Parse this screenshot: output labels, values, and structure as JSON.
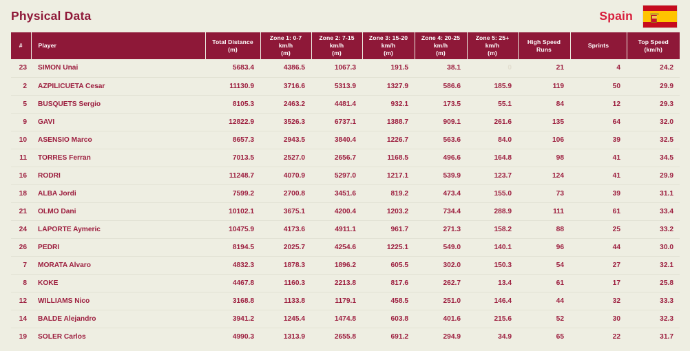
{
  "header": {
    "title": "Physical Data",
    "team": "Spain",
    "flag_icon": "spain-flag-icon",
    "title_color": "#8e1838",
    "team_color": "#d81e3c",
    "header_band_color": "#8e1838",
    "background_color": "#eeeee2",
    "value_color": "#9c1d3e"
  },
  "table": {
    "columns": [
      {
        "key": "num",
        "label": "#"
      },
      {
        "key": "name",
        "label": "Player"
      },
      {
        "key": "total",
        "label": "Total Distance\n(m)",
        "line1": "Total Distance",
        "line2": "(m)"
      },
      {
        "key": "z1",
        "label": "Zone 1: 0-7 km/h\n(m)",
        "line1": "Zone 1: 0-7 km/h",
        "line2": "(m)"
      },
      {
        "key": "z2",
        "label": "Zone 2: 7-15 km/h\n(m)",
        "line1": "Zone 2: 7-15 km/h",
        "line2": "(m)"
      },
      {
        "key": "z3",
        "label": "Zone 3: 15-20 km/h\n(m)",
        "line1": "Zone 3: 15-20 km/h",
        "line2": "(m)"
      },
      {
        "key": "z4",
        "label": "Zone 4: 20-25 km/h\n(m)",
        "line1": "Zone 4: 20-25 km/h",
        "line2": "(m)"
      },
      {
        "key": "z5",
        "label": "Zone 5: 25+ km/h\n(m)",
        "line1": "Zone 5: 25+ km/h",
        "line2": "(m)"
      },
      {
        "key": "hsr",
        "label": "High Speed Runs",
        "line1": "High Speed Runs",
        "line2": ""
      },
      {
        "key": "spr",
        "label": "Sprints",
        "line1": "Sprints",
        "line2": ""
      },
      {
        "key": "ts",
        "label": "Top Speed\n(km/h)",
        "line1": "Top Speed",
        "line2": "(km/h)"
      }
    ],
    "rows": [
      {
        "num": "23",
        "name": "SIMON Unai",
        "total": "5683.4",
        "z1": "4386.5",
        "z2": "1067.3",
        "z3": "191.5",
        "z4": "38.1",
        "z5": "0",
        "z5_faint": true,
        "hsr": "21",
        "spr": "4",
        "ts": "24.2"
      },
      {
        "num": "2",
        "name": "AZPILICUETA Cesar",
        "total": "11130.9",
        "z1": "3716.6",
        "z2": "5313.9",
        "z3": "1327.9",
        "z4": "586.6",
        "z5": "185.9",
        "z5_faint": false,
        "hsr": "119",
        "spr": "50",
        "ts": "29.9"
      },
      {
        "num": "5",
        "name": "BUSQUETS Sergio",
        "total": "8105.3",
        "z1": "2463.2",
        "z2": "4481.4",
        "z3": "932.1",
        "z4": "173.5",
        "z5": "55.1",
        "z5_faint": false,
        "hsr": "84",
        "spr": "12",
        "ts": "29.3"
      },
      {
        "num": "9",
        "name": "GAVI",
        "total": "12822.9",
        "z1": "3526.3",
        "z2": "6737.1",
        "z3": "1388.7",
        "z4": "909.1",
        "z5": "261.6",
        "z5_faint": false,
        "hsr": "135",
        "spr": "64",
        "ts": "32.0"
      },
      {
        "num": "10",
        "name": "ASENSIO Marco",
        "total": "8657.3",
        "z1": "2943.5",
        "z2": "3840.4",
        "z3": "1226.7",
        "z4": "563.6",
        "z5": "84.0",
        "z5_faint": false,
        "hsr": "106",
        "spr": "39",
        "ts": "32.5"
      },
      {
        "num": "11",
        "name": "TORRES Ferran",
        "total": "7013.5",
        "z1": "2527.0",
        "z2": "2656.7",
        "z3": "1168.5",
        "z4": "496.6",
        "z5": "164.8",
        "z5_faint": false,
        "hsr": "98",
        "spr": "41",
        "ts": "34.5"
      },
      {
        "num": "16",
        "name": "RODRI",
        "total": "11248.7",
        "z1": "4070.9",
        "z2": "5297.0",
        "z3": "1217.1",
        "z4": "539.9",
        "z5": "123.7",
        "z5_faint": false,
        "hsr": "124",
        "spr": "41",
        "ts": "29.9"
      },
      {
        "num": "18",
        "name": "ALBA Jordi",
        "total": "7599.2",
        "z1": "2700.8",
        "z2": "3451.6",
        "z3": "819.2",
        "z4": "473.4",
        "z5": "155.0",
        "z5_faint": false,
        "hsr": "73",
        "spr": "39",
        "ts": "31.1"
      },
      {
        "num": "21",
        "name": "OLMO Dani",
        "total": "10102.1",
        "z1": "3675.1",
        "z2": "4200.4",
        "z3": "1203.2",
        "z4": "734.4",
        "z5": "288.9",
        "z5_faint": false,
        "hsr": "111",
        "spr": "61",
        "ts": "33.4"
      },
      {
        "num": "24",
        "name": "LAPORTE Aymeric",
        "total": "10475.9",
        "z1": "4173.6",
        "z2": "4911.1",
        "z3": "961.7",
        "z4": "271.3",
        "z5": "158.2",
        "z5_faint": false,
        "hsr": "88",
        "spr": "25",
        "ts": "33.2"
      },
      {
        "num": "26",
        "name": "PEDRI",
        "total": "8194.5",
        "z1": "2025.7",
        "z2": "4254.6",
        "z3": "1225.1",
        "z4": "549.0",
        "z5": "140.1",
        "z5_faint": false,
        "hsr": "96",
        "spr": "44",
        "ts": "30.0"
      },
      {
        "num": "7",
        "name": "MORATA Alvaro",
        "total": "4832.3",
        "z1": "1878.3",
        "z2": "1896.2",
        "z3": "605.5",
        "z4": "302.0",
        "z5": "150.3",
        "z5_faint": false,
        "hsr": "54",
        "spr": "27",
        "ts": "32.1"
      },
      {
        "num": "8",
        "name": "KOKE",
        "total": "4467.8",
        "z1": "1160.3",
        "z2": "2213.8",
        "z3": "817.6",
        "z4": "262.7",
        "z5": "13.4",
        "z5_faint": false,
        "hsr": "61",
        "spr": "17",
        "ts": "25.8"
      },
      {
        "num": "12",
        "name": "WILLIAMS Nico",
        "total": "3168.8",
        "z1": "1133.8",
        "z2": "1179.1",
        "z3": "458.5",
        "z4": "251.0",
        "z5": "146.4",
        "z5_faint": false,
        "hsr": "44",
        "spr": "32",
        "ts": "33.3"
      },
      {
        "num": "14",
        "name": "BALDE Alejandro",
        "total": "3941.2",
        "z1": "1245.4",
        "z2": "1474.8",
        "z3": "603.8",
        "z4": "401.6",
        "z5": "215.6",
        "z5_faint": false,
        "hsr": "52",
        "spr": "30",
        "ts": "32.3"
      },
      {
        "num": "19",
        "name": "SOLER Carlos",
        "total": "4990.3",
        "z1": "1313.9",
        "z2": "2655.8",
        "z3": "691.2",
        "z4": "294.9",
        "z5": "34.9",
        "z5_faint": false,
        "hsr": "65",
        "spr": "22",
        "ts": "31.7"
      }
    ]
  }
}
